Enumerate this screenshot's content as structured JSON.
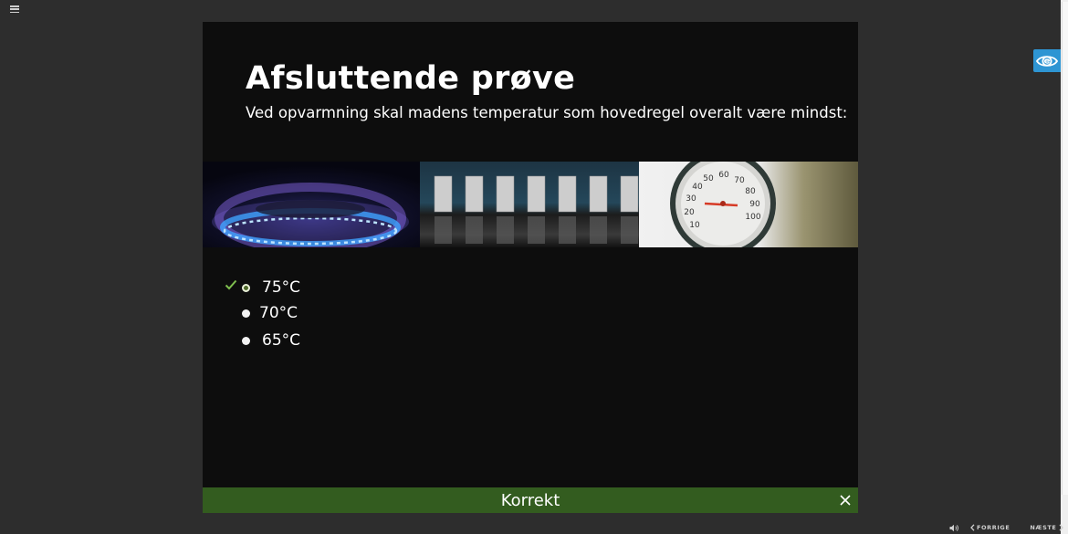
{
  "slide": {
    "title": "Afsluttende prøve",
    "question": "Ved opvarmning skal madens temperatur som hovedregel overalt være mindst:"
  },
  "images": [
    {
      "icon": "gas-flame-image"
    },
    {
      "icon": "doors-image"
    },
    {
      "icon": "thermometer-image",
      "dial_numbers": [
        "10",
        "20",
        "30",
        "40",
        "50",
        "60",
        "70",
        "80",
        "90",
        "100"
      ]
    }
  ],
  "options": [
    {
      "label": "75°C",
      "selected": true,
      "correct": true
    },
    {
      "label": "70°C",
      "selected": false
    },
    {
      "label": "65°C",
      "selected": false
    }
  ],
  "feedback": {
    "text": "Korrekt",
    "color": "#335c1f"
  },
  "nav": {
    "prev_label": "FORRIGE",
    "next_label": "NÆSTE"
  },
  "icons": {
    "menu": "hamburger-menu-icon",
    "accessibility": "eye-icon",
    "audio": "speaker-icon",
    "prev": "chevron-left-icon",
    "next": "chevron-right-icon",
    "close": "close-icon",
    "correct": "checkmark-icon"
  },
  "colors": {
    "page_bg": "#2d2d2d",
    "slide_bg": "#0d0d0d",
    "accent_blue": "#2e95d3",
    "correct_green": "#7fbf4f"
  }
}
